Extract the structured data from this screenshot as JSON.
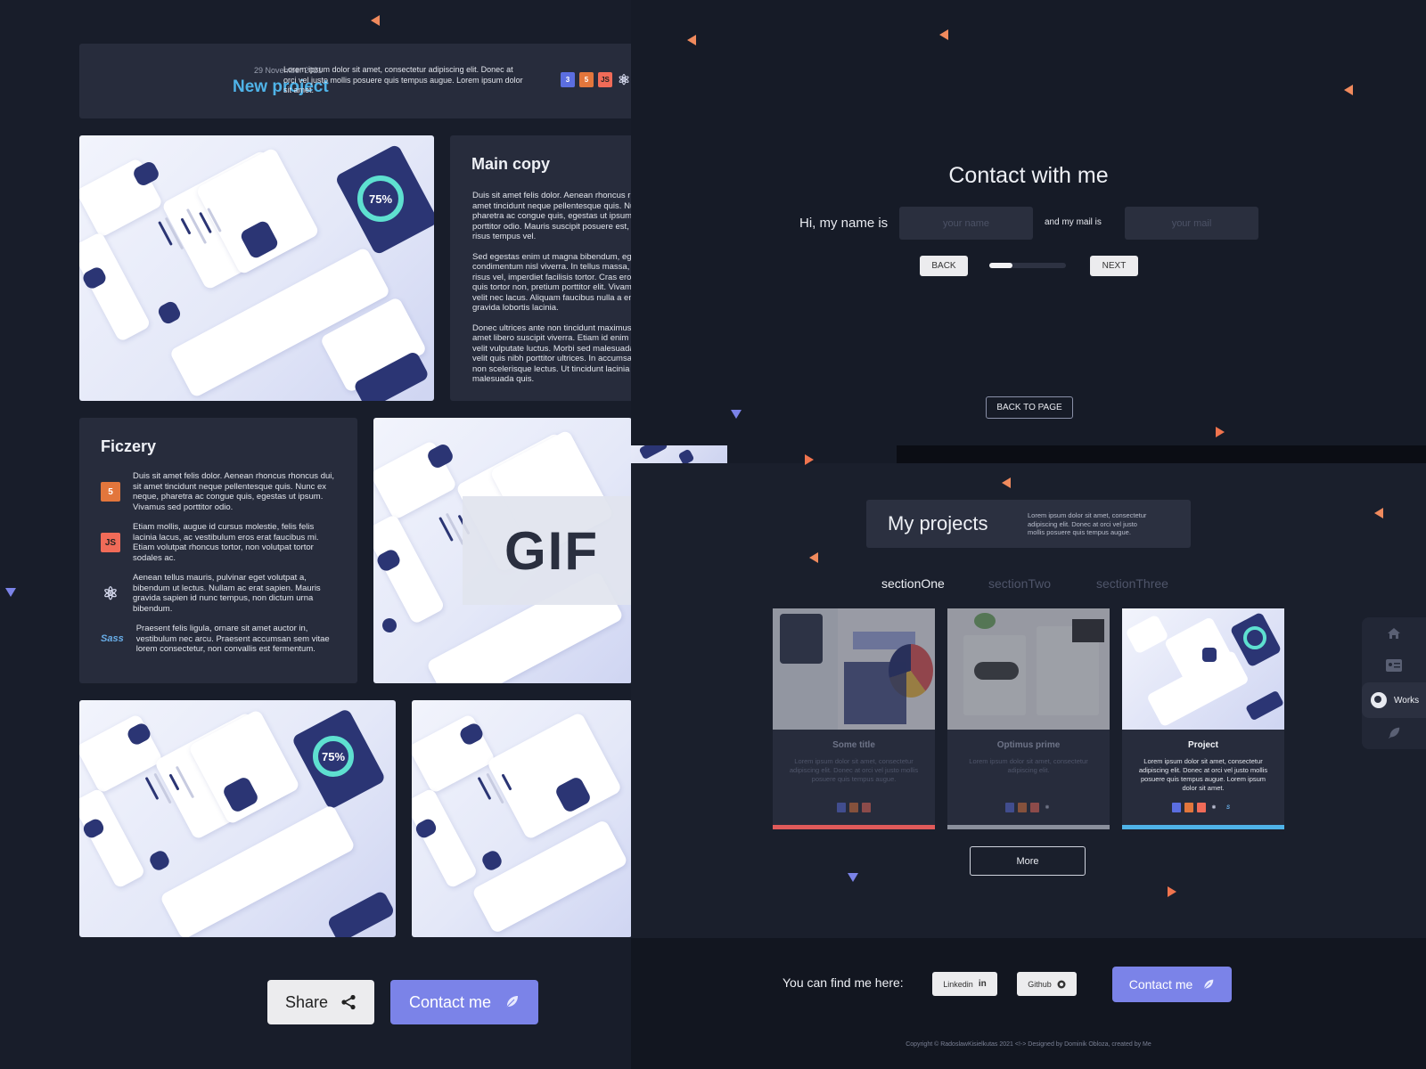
{
  "project": {
    "date": "29 November 2021",
    "title": "New project",
    "description": "Lorem ipsum dolor sit amet, consectetur adipiscing elit. Donec at orci vel justo mollis posuere quis tempus augue. Lorem ipsum dolor sit amet.",
    "tech_icons": [
      "css3-icon",
      "html5-icon",
      "js-icon",
      "react-icon"
    ],
    "tech_labels": {
      "css": "3",
      "html": "5",
      "js": "JS",
      "react": "⚛"
    }
  },
  "main_copy": {
    "title": "Main copy",
    "paragraphs": [
      "Duis sit amet felis dolor. Aenean rhoncus rhoncus dui, sit amet tincidunt neque pellentesque quis. Nunc ex neque, pharetra ac congue quis, egestas ut ipsum. Vivamus sed porttitor odio. Mauris suscipit posuere est, vitae mollis risus tempus vel.",
      "Sed egestas enim ut magna bibendum, eget condimentum nisl viverra. In tellus massa, maximus eu risus vel, imperdiet facilisis tortor. Cras eros ex, rhoncus quis tortor non, pretium porttitor elit. Vivamus venenatis velit nec lacus. Aliquam faucibus nulla a enim dapibus, gravida lobortis lacinia.",
      "Donec ultrices ante non tincidunt maximus. Integer sit amet libero suscipit viverra. Etiam id enim odio. Nulla eu velit vulputate luctus. Morbi sed malesuada lectus, in velit quis nibh porttitor ultrices. In accumsan nisi erat, non scelerisque lectus. Ut tincidunt lacinia placerat nisl malesuada quis."
    ]
  },
  "features": {
    "title": "Ficzery",
    "items": [
      {
        "icon": "html5-icon",
        "glyph": "5",
        "text": "Duis sit amet felis dolor. Aenean rhoncus rhoncus dui, sit amet tincidunt neque pellentesque quis. Nunc ex neque, pharetra ac congue quis, egestas ut ipsum. Vivamus sed porttitor odio."
      },
      {
        "icon": "js-icon",
        "glyph": "JS",
        "text": "Etiam mollis, augue id cursus molestie, felis felis lacinia lacus, ac vestibulum eros erat faucibus mi. Etiam volutpat rhoncus tortor, non volutpat tortor sodales ac."
      },
      {
        "icon": "react-icon",
        "glyph": "⚛",
        "text": "Aenean tellus mauris, pulvinar eget volutpat a, bibendum ut lectus. Nullam ac erat sapien. Mauris gravida sapien id nunc tempus, non dictum urna bibendum."
      },
      {
        "icon": "sass-icon",
        "glyph": "Sass",
        "text": " Praesent felis ligula, ornare sit amet auctor in, vestibulum nec arcu. Praesent accumsan sem vitae lorem consectetur, non convallis est fermentum."
      }
    ]
  },
  "gif_label": "GIF",
  "mockup_ring_value": "75%",
  "actions": {
    "share": "Share",
    "contact": "Contact me"
  },
  "contact_form": {
    "title": "Contact with me",
    "name_label": "Hi, my name is",
    "name_placeholder": "your name",
    "mail_label": "and my mail is",
    "mail_placeholder": "your mail",
    "back": "BACK",
    "next": "NEXT",
    "progress": 0.3,
    "back_to_page": "BACK TO PAGE"
  },
  "projects": {
    "title": "My projects",
    "description": "Lorem ipsum dolor sit amet, consectetur adipiscing elit. Donec at orci vel justo mollis posuere quis tempus augue.",
    "tabs": [
      "sectionOne",
      "sectionTwo",
      "sectionThree"
    ],
    "active_tab": 0,
    "cards": [
      {
        "title": "Some title",
        "description": "Lorem ipsum dolor sit amet, consectetur adipiscing elit. Donec at orci vel justo mollis posuere quis tempus augue.",
        "accent": "#e05a5a",
        "active": false
      },
      {
        "title": "Optimus prime",
        "description": "Lorem ipsum dolor sit amet, consectetur adipiscing elit.",
        "accent": "#8a8f9c",
        "active": false
      },
      {
        "title": "Project",
        "description": "Lorem ipsum dolor sit amet, consectetur adipiscing elit. Donec at orci vel justo mollis posuere quis tempus augue. Lorem ipsum dolor sit amet.",
        "accent": "#4fb3e8",
        "active": true
      }
    ],
    "more": "More"
  },
  "sidenav": {
    "items": [
      "home-icon",
      "contact-card-icon",
      "globe-icon",
      "feather-icon"
    ],
    "active_label": "Works"
  },
  "footer": {
    "find_text": "You can find me here:",
    "linkedin": "Linkedin",
    "github": "Github",
    "contact": "Contact me",
    "copyright": "Copyright © RadoslawKisielkutas 2021 <!-> Designed by Dominik Obloza, created by Me"
  },
  "colors": {
    "accent": "#7b83e8",
    "title_blue": "#4fb3e8",
    "card_bg": "#272c3c",
    "triangle_orange": "#f08a5d",
    "triangle_blue": "#7b83e8"
  }
}
